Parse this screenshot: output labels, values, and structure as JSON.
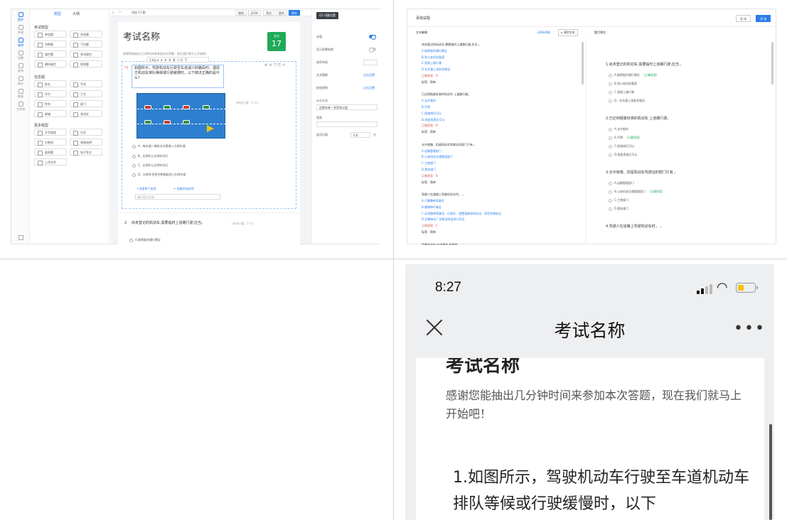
{
  "q1": {
    "rail": [
      "题库",
      "外观",
      "编辑",
      "设置",
      "发布",
      "统计",
      "报表",
      "工作流"
    ],
    "lib_tabs": [
      "题型",
      "大纲"
    ],
    "sections": {
      "exam": "考试题型",
      "info": "信息题",
      "more": "更多题型"
    },
    "exam_chips": [
      "单选题",
      "多选题",
      "判断题",
      "下拉题",
      "填空题",
      "多项填空",
      "横向填空",
      "简答题"
    ],
    "info_chips": [
      "姓名",
      "手机",
      "学号",
      "工号",
      "性别",
      "部门",
      "邮箱",
      "身份证"
    ],
    "more_chips": [
      "文字描述",
      "分页",
      "分割线",
      "表格选择",
      "量表题",
      "电子签名",
      "上传文件"
    ],
    "toolbar": {
      "search_text": "添加 17 题",
      "buttons": [
        "撤销",
        "JSON",
        "预览",
        "题库",
        "保存"
      ]
    },
    "sheet": {
      "title": "考试名称",
      "subtitle": "感谢您能抽出几分钟时间来参加本次答题，现在我们就马上开始吧！",
      "score_label": "总分",
      "score_value": "17",
      "q1_no": "*1",
      "q1_stem": "如图所示，驾驶机动车行驶至车道减少的路段时，遇前方机动车排队等候或行驶缓慢时，以下做法正确的是什么？",
      "format_bar": "14px ▾ A A B I U T",
      "q1_score": "(单选分值：5 分)",
      "q1_options": [
        "A、每车道一辆依次交替驶入左侧车道",
        "B、右侧车让右侧车先行",
        "C、右侧车让左侧车先行",
        "D、右侧车寻找空隙驶超进入左侧车道"
      ],
      "add_option": "+添加单个选项",
      "bulk_add": "+ 批量添加选项",
      "hint_placeholder": "填写提示信息",
      "q2_no": "2",
      "q2_stem": "尚未登记的机动车,需要临时上道路行驶,应当。",
      "q2_score": "(单选分值：0 分)",
      "q2_option": "A.取得临时通行牌证"
    },
    "props": {
      "header": "Q1 问题设置",
      "required": "必填",
      "show_result": "显示投票结果",
      "layout": "选项布局",
      "text_replace": "文本替换",
      "text_replace_link": "点击设置",
      "rule": "校验规则",
      "rule_link": "点击设置",
      "scoring": "计分方式",
      "scoring_value": "此题有唯一答案和分值",
      "answer": "答案",
      "score": "此项分值",
      "score_value": "5.0",
      "unit": "分"
    }
  },
  "q2": {
    "title": "添加试题",
    "btn_close": "关 闭",
    "btn_add": "添 加",
    "editor_label": "文本编辑",
    "example": "示例&帮助",
    "clear": "清空文本",
    "preview_label": "题目预览",
    "editor_lines": [
      {
        "t": "尚未登记的机动车,需要临时上道路行驶,应当 。",
        "k": "n"
      },
      {
        "t": "A.取得临时通行牌证",
        "k": "o"
      },
      {
        "t": "B.到公安机关备案",
        "k": "o"
      },
      {
        "t": "C.直接上路行驶",
        "k": "o"
      },
      {
        "t": "D.在车窗上张贴合格证",
        "k": "o"
      },
      {
        "t": "正确答案：A",
        "k": "k"
      },
      {
        "t": "标签：简单",
        "k": "n"
      },
      {
        "t": "",
        "k": "n"
      },
      {
        "t": "已达到报废标准的机动车 上道路行驶。",
        "k": "n"
      },
      {
        "t": "A.允许临时",
        "k": "o"
      },
      {
        "t": "B.不得",
        "k": "o"
      },
      {
        "t": "C.经维修后可以",
        "k": "o"
      },
      {
        "t": "D.改变用途后可以",
        "k": "o"
      },
      {
        "t": "正确答案：B",
        "k": "k"
      },
      {
        "t": "标签：简单",
        "k": "n"
      },
      {
        "t": "",
        "k": "n"
      },
      {
        "t": "允许收缴、扣留机动车驾驶证的部门只有 。",
        "k": "n"
      },
      {
        "t": "A.运输管理部门",
        "k": "o"
      },
      {
        "t": "B.公安机关交通管理部门",
        "k": "o"
      },
      {
        "t": "C.工商部门",
        "k": "o"
      },
      {
        "t": "D.税务部门",
        "k": "o"
      },
      {
        "t": "正确答案：B",
        "k": "k"
      },
      {
        "t": "标签：简单",
        "k": "n"
      },
      {
        "t": "",
        "k": "n"
      },
      {
        "t": "驾驶人在道路上驾驶机动车时， 。",
        "k": "n"
      },
      {
        "t": "A.只需携带驾驶证",
        "k": "o"
      },
      {
        "t": "B.需携带行驶证",
        "k": "o"
      },
      {
        "t": "C.必须携带驾驶证、行驶证、放置强制保险标志、检验合格标志",
        "k": "o"
      },
      {
        "t": "D.应携带出厂合格证明或进口凭证",
        "k": "o"
      },
      {
        "t": "正确答案：C",
        "k": "k"
      },
      {
        "t": "标签：简单",
        "k": "n"
      },
      {
        "t": "",
        "k": "n"
      },
      {
        "t": "驾驶机动车 必须遵守 的规则",
        "k": "n"
      }
    ],
    "preview": [
      {
        "q": "1.尚未登记的机动车,需要临时上道路行驶,应当 。",
        "opts": [
          "A.取得临时通行牌证",
          "B.到公安机关备案",
          "C.直接上路行驶",
          "D、在车窗上张贴合格证"
        ],
        "ans": 0
      },
      {
        "q": "2.已达到报废标准的机动车 上道路行驶。",
        "opts": [
          "A.允许临时",
          "B.不得",
          "C.经维修后可以",
          "D.改变用途后可以"
        ],
        "ans": 1
      },
      {
        "q": "3.允许收缴、扣留机动车驾驶证的部门只有 。",
        "opts": [
          "A.运输管理部门",
          "B.公安机关交通管理部门",
          "C.工商部门",
          "D.税务部门"
        ],
        "ans": 1
      },
      {
        "q": "4.驾驶人在道路上驾驶机动车时， 。",
        "opts": [],
        "ans": -1
      }
    ],
    "answer_tag": "（正确答案）"
  },
  "q4": {
    "time": "8:27",
    "nav_title": "考试名称",
    "more": "•••",
    "title": "考试名称",
    "subtitle": "感谢您能抽出几分钟时间来参加本次答题，现在我们就马上开始吧！",
    "question": "1.如图所示，驾驶机动车行驶至车道机动车排队等候或行驶缓慢时，以下"
  },
  "colors": {
    "accent": "#2b7de9",
    "score_green": "#1faa59",
    "answer_green": "#1faa59",
    "required_red": "#e4504a"
  }
}
